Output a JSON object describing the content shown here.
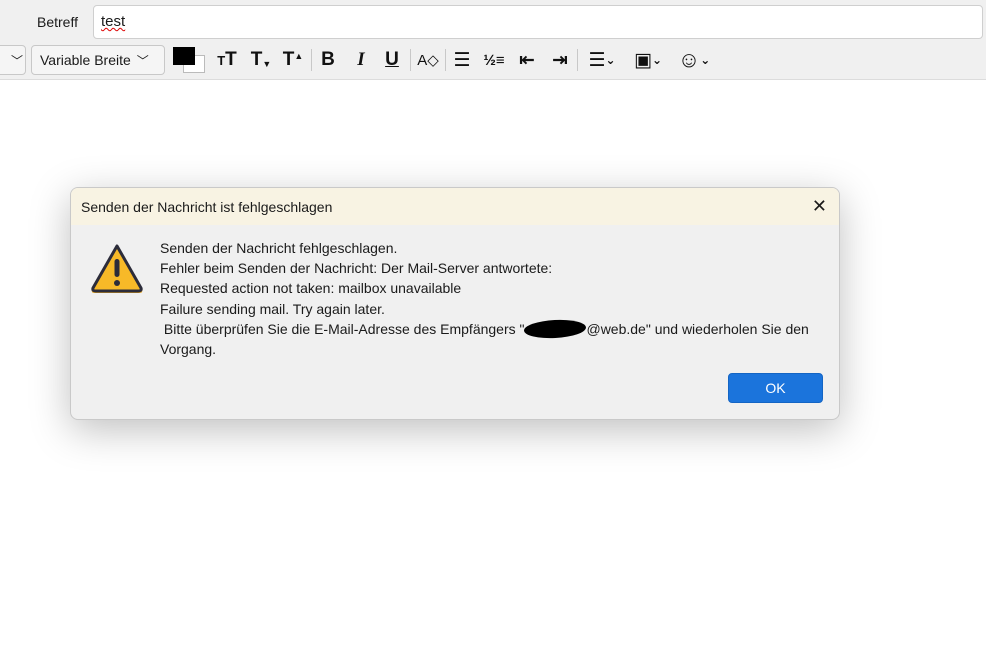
{
  "compose": {
    "subject_label": "Betreff",
    "subject_value": "test"
  },
  "toolbar": {
    "font_select": "Variable Breite",
    "buttons": [
      "font-smaller",
      "font-larger",
      "superscript",
      "bold",
      "italic",
      "underline",
      "clear-format",
      "bullet-list",
      "numbered-list",
      "outdent",
      "indent",
      "align",
      "insert-image",
      "emoji"
    ],
    "glyphs": {
      "smaller": "ᴛT",
      "tsub": "T▾",
      "tsup": "T▴",
      "bold": "B",
      "italic": "I",
      "underline": "U",
      "bullet": "☰",
      "numbered": "⒈",
      "align": "☰",
      "image": "▣",
      "emoji": "☺",
      "chev": "⌄"
    }
  },
  "dialog": {
    "title": "Senden der Nachricht ist fehlgeschlagen",
    "lines": [
      "Senden der Nachricht fehlgeschlagen.",
      "Fehler beim Senden der Nachricht: Der Mail-Server antwortete:",
      "Requested action not taken: mailbox unavailable",
      "Failure sending mail. Try again later."
    ],
    "line5_pre": " Bitte überprüfen Sie die E-Mail-Adresse des Empfängers \"",
    "line5_post": "@web.de\" und wiederholen Sie den Vorgang.",
    "ok_label": "OK",
    "close_glyph": "✕"
  },
  "colors": {
    "accent": "#1b74dc",
    "title_bg": "#f8f3e3",
    "warning": "#f7b928"
  }
}
